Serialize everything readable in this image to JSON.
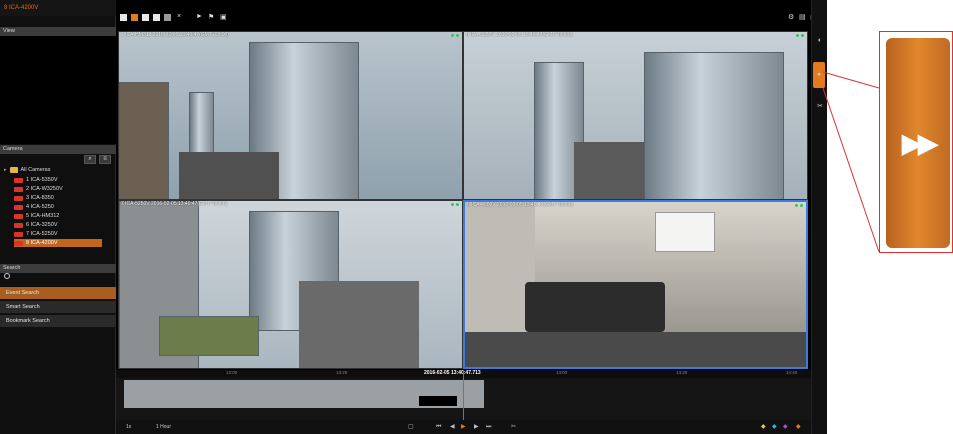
{
  "app": {
    "title": "8 ICA-4200V"
  },
  "left": {
    "view_header": "View",
    "camera_header": "Camera",
    "tree_root": "All Cameras",
    "cameras": [
      "1 ICA-5350V",
      "2 ICA-W3250V",
      "3 ICA-8350",
      "4 ICA-5250",
      "5 ICA-HM312",
      "6 ICA-3250V",
      "7 ICA-5250V",
      "8 ICA-4200V"
    ],
    "selected_camera_index": 7,
    "search_header": "Search",
    "menu": [
      "Event Search",
      "Smart Search",
      "Bookmark Search"
    ],
    "active_menu_index": 0
  },
  "tiles": [
    {
      "label": "1 ICA-HM312  2016-02-05 13:40:47(GMT+08:00)"
    },
    {
      "label": "6 ICA-3250V  2016-02-05 13:40:47(GMT+08:00)"
    },
    {
      "label": "7 ICA-5250V  2016-02-05 13:40:47(GMT+08:00)"
    },
    {
      "label": "8 ICA-4200V  2016-02-05 13:40:47(GMT+08:00)"
    }
  ],
  "timeline": {
    "current_time": "2016-02-05 13:40:47.713",
    "ticks": [
      "13:00",
      "13:20",
      "13:40",
      "14:00",
      "14:20",
      "14:40"
    ]
  },
  "bottom": {
    "speed": "1x",
    "range": "1 Hour"
  },
  "colors": {
    "accent": "#e07b20",
    "selected_border": "#3a7be0",
    "callout": "#dd3333"
  },
  "icons": {
    "callout_button": "fast-forward-icon"
  }
}
